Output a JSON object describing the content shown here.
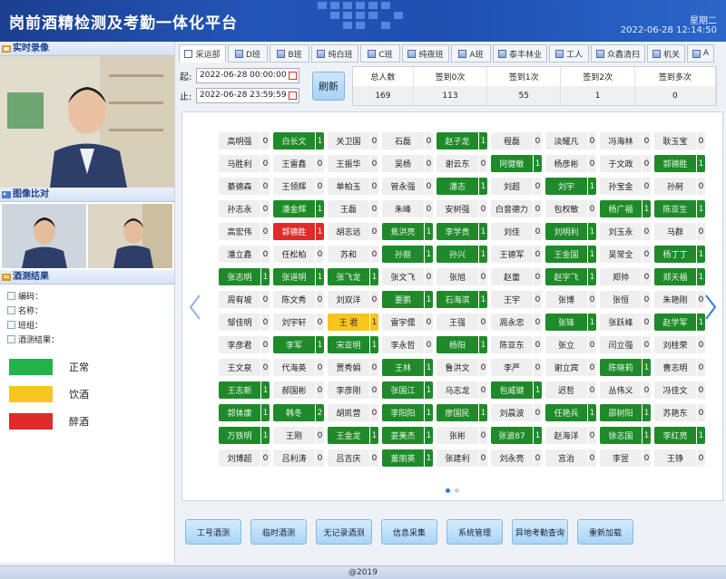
{
  "header": {
    "title": "岗前酒精检测及考勤一体化平台",
    "weekday": "星期二",
    "datetime": "2022-06-28 12:14:50"
  },
  "left": {
    "realtime_title": "实时录像",
    "compare_title": "图像比对",
    "result_title": "酒测结果",
    "fields": [
      "编码：",
      "名称：",
      "班组：",
      "酒测结果："
    ],
    "legend": [
      {
        "label": "正常",
        "color": "#22b34a"
      },
      {
        "label": "饮酒",
        "color": "#f7c51e"
      },
      {
        "label": "醉酒",
        "color": "#e12a2a"
      }
    ]
  },
  "tabs": [
    "采运部",
    "D班",
    "B班",
    "纯白班",
    "C班",
    "纯夜班",
    "A班",
    "泰丰林业",
    "工人",
    "众鑫清扫",
    "机关",
    "A"
  ],
  "time": {
    "start_label": "起:",
    "start_value": "2022-06-28 00:00:00",
    "end_label": "止:",
    "end_value": "2022-06-28 23:59:59",
    "refresh": "刷新"
  },
  "stats": {
    "headers": [
      "总人数",
      "签到0次",
      "签到1次",
      "签到2次",
      "签到多次"
    ],
    "values": [
      "169",
      "113",
      "55",
      "1",
      "0"
    ]
  },
  "grid_rows": [
    [
      [
        "高明强",
        "0",
        ""
      ],
      [
        "白长文",
        "1",
        "g"
      ],
      [
        "关卫国",
        "0",
        ""
      ],
      [
        "石磊",
        "0",
        ""
      ],
      [
        "赵子龙",
        "1",
        "g"
      ],
      [
        "程磊",
        "0",
        ""
      ],
      [
        "淡耀凡",
        "0",
        ""
      ],
      [
        "冯海林",
        "0",
        ""
      ],
      [
        "耿玉宝",
        "0",
        ""
      ]
    ],
    [
      [
        "马胜利",
        "0",
        ""
      ],
      [
        "王雷鑫",
        "0",
        ""
      ],
      [
        "王振华",
        "0",
        ""
      ],
      [
        "吴杨",
        "0",
        ""
      ],
      [
        "谢云东",
        "0",
        ""
      ],
      [
        "阿健敏",
        "1",
        "g"
      ],
      [
        "杨彦彬",
        "0",
        ""
      ],
      [
        "于文政",
        "0",
        ""
      ],
      [
        "郭德胜",
        "1",
        "g"
      ]
    ],
    [
      [
        "綦德森",
        "0",
        ""
      ],
      [
        "王领辉",
        "0",
        ""
      ],
      [
        "单柏玉",
        "0",
        ""
      ],
      [
        "管永强",
        "0",
        ""
      ],
      [
        "潘志",
        "1",
        "g"
      ],
      [
        "刘超",
        "0",
        ""
      ],
      [
        "刘宇",
        "1",
        "g"
      ],
      [
        "孙宝金",
        "0",
        ""
      ],
      [
        "孙舸",
        "0",
        ""
      ]
    ],
    [
      [
        "孙志永",
        "0",
        ""
      ],
      [
        "潘金辉",
        "1",
        "g"
      ],
      [
        "王磊",
        "0",
        ""
      ],
      [
        "朱峰",
        "0",
        ""
      ],
      [
        "安树强",
        "0",
        ""
      ],
      [
        "白音德力",
        "0",
        ""
      ],
      [
        "包权敏",
        "0",
        ""
      ],
      [
        "杨广福",
        "1",
        "g"
      ],
      [
        "陈亚生",
        "1",
        "g"
      ]
    ],
    [
      [
        "高宏伟",
        "0",
        ""
      ],
      [
        "郭德胜",
        "1",
        "r"
      ],
      [
        "胡志远",
        "0",
        ""
      ],
      [
        "焦洪亮",
        "1",
        "g"
      ],
      [
        "李学贵",
        "1",
        "g"
      ],
      [
        "刘佳",
        "0",
        ""
      ],
      [
        "刘明利",
        "1",
        "g"
      ],
      [
        "刘玉永",
        "0",
        ""
      ],
      [
        "马群",
        "0",
        ""
      ]
    ],
    [
      [
        "潘立鑫",
        "0",
        ""
      ],
      [
        "任松柏",
        "0",
        ""
      ],
      [
        "苏和",
        "0",
        ""
      ],
      [
        "孙丽",
        "1",
        "g"
      ],
      [
        "孙兴",
        "1",
        "g"
      ],
      [
        "王德军",
        "0",
        ""
      ],
      [
        "王金国",
        "1",
        "g"
      ],
      [
        "吴常全",
        "0",
        ""
      ],
      [
        "杨丁丁",
        "1",
        "g"
      ]
    ],
    [
      [
        "张志明",
        "1",
        "g"
      ],
      [
        "张道明",
        "1",
        "g"
      ],
      [
        "张飞龙",
        "1",
        "g"
      ],
      [
        "张文飞",
        "0",
        ""
      ],
      [
        "张旭",
        "0",
        ""
      ],
      [
        "赵蕾",
        "0",
        ""
      ],
      [
        "赵宇飞",
        "1",
        "g"
      ],
      [
        "郑帅",
        "0",
        ""
      ],
      [
        "郑天福",
        "1",
        "g"
      ]
    ],
    [
      [
        "周有坡",
        "0",
        ""
      ],
      [
        "陈文秀",
        "0",
        ""
      ],
      [
        "刘双洋",
        "0",
        ""
      ],
      [
        "要鹏",
        "1",
        "g"
      ],
      [
        "石海滨",
        "1",
        "g"
      ],
      [
        "王宇",
        "0",
        ""
      ],
      [
        "张博",
        "0",
        ""
      ],
      [
        "张恒",
        "0",
        ""
      ],
      [
        "朱艳刚",
        "0",
        ""
      ]
    ],
    [
      [
        "邹佳明",
        "0",
        ""
      ],
      [
        "刘宇轩",
        "0",
        ""
      ],
      [
        "王 君",
        "1",
        "y"
      ],
      [
        "雷宇儒",
        "0",
        ""
      ],
      [
        "王强",
        "0",
        ""
      ],
      [
        "周永忠",
        "0",
        ""
      ],
      [
        "张锋",
        "1",
        "g"
      ],
      [
        "张跃峰",
        "0",
        ""
      ],
      [
        "赵学军",
        "1",
        "g"
      ]
    ],
    [
      [
        "李彦君",
        "0",
        ""
      ],
      [
        "李军",
        "1",
        "g"
      ],
      [
        "宋亚明",
        "1",
        "g"
      ],
      [
        "李永哲",
        "0",
        ""
      ],
      [
        "杨阳",
        "1",
        "g"
      ],
      [
        "陈亚东",
        "0",
        ""
      ],
      [
        "张立",
        "0",
        ""
      ],
      [
        "闫立强",
        "0",
        ""
      ],
      [
        "刘桂荣",
        "0",
        ""
      ]
    ],
    [
      [
        "王文泉",
        "0",
        ""
      ],
      [
        "代海英",
        "0",
        ""
      ],
      [
        "贾秀娟",
        "0",
        ""
      ],
      [
        "王林",
        "1",
        "g"
      ],
      [
        "鲁洪文",
        "0",
        ""
      ],
      [
        "李严",
        "0",
        ""
      ],
      [
        "谢立宾",
        "0",
        ""
      ],
      [
        "陈晓莉",
        "1",
        "g"
      ],
      [
        "曹志明",
        "0",
        ""
      ]
    ],
    [
      [
        "王志新",
        "1",
        "g"
      ],
      [
        "郝国彬",
        "0",
        ""
      ],
      [
        "李彦刚",
        "0",
        ""
      ],
      [
        "张国江",
        "1",
        "g"
      ],
      [
        "马志龙",
        "0",
        ""
      ],
      [
        "包威键",
        "1",
        "g"
      ],
      [
        "迟哲",
        "0",
        ""
      ],
      [
        "丛伟义",
        "0",
        ""
      ],
      [
        "冯佳文",
        "0",
        ""
      ]
    ],
    [
      [
        "郭体康",
        "1",
        "g"
      ],
      [
        "韩冬",
        "2",
        "g"
      ],
      [
        "胡凯营",
        "0",
        ""
      ],
      [
        "李阳阳",
        "1",
        "g"
      ],
      [
        "廖国民",
        "1",
        "g"
      ],
      [
        "刘晨波",
        "0",
        ""
      ],
      [
        "任艳兵",
        "1",
        "g"
      ],
      [
        "邵树阳",
        "1",
        "g"
      ],
      [
        "苏艳东",
        "0",
        ""
      ]
    ],
    [
      [
        "万铁明",
        "1",
        "g"
      ],
      [
        "王刚",
        "0",
        ""
      ],
      [
        "王金龙",
        "1",
        "g"
      ],
      [
        "姜美杰",
        "1",
        "g"
      ],
      [
        "张彬",
        "0",
        ""
      ],
      [
        "张波87",
        "1",
        "g"
      ],
      [
        "赵海洋",
        "0",
        ""
      ],
      [
        "徐志国",
        "1",
        "g"
      ],
      [
        "李红亮",
        "1",
        "g"
      ]
    ],
    [
      [
        "刘博超",
        "0",
        ""
      ],
      [
        "吕利涛",
        "0",
        ""
      ],
      [
        "吕吉庆",
        "0",
        ""
      ],
      [
        "董丽英",
        "1",
        "g"
      ],
      [
        "张建利",
        "0",
        ""
      ],
      [
        "刘永亮",
        "0",
        ""
      ],
      [
        "宫治",
        "0",
        ""
      ],
      [
        "李昱",
        "0",
        ""
      ],
      [
        "王铮",
        "0",
        ""
      ]
    ]
  ],
  "actions": [
    "工号酒测",
    "临时酒测",
    "无记录酒测",
    "信息采集",
    "系统管理",
    "异地考勤查询",
    "重新加载"
  ],
  "footer": "@2019"
}
